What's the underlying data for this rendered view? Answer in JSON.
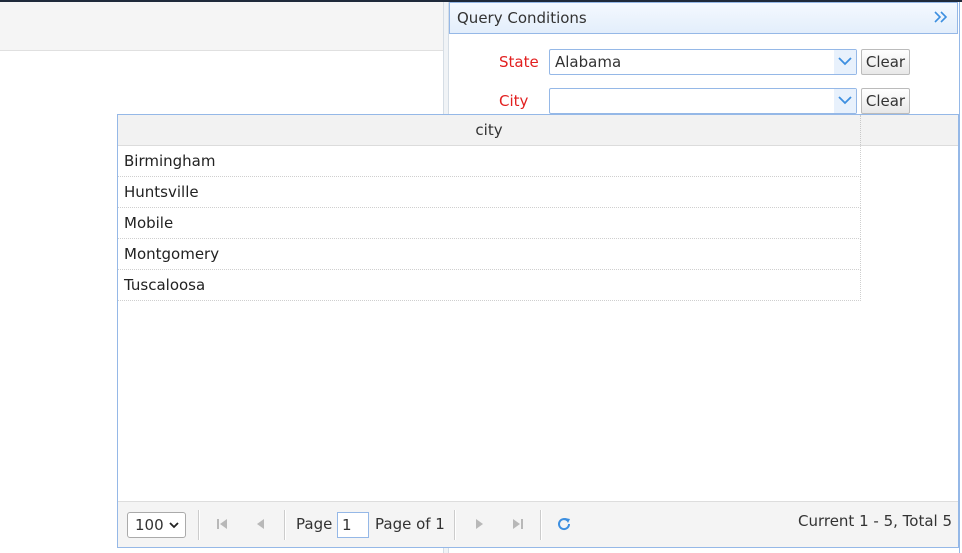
{
  "query_panel": {
    "title": "Query Conditions",
    "state_label": "State",
    "state_value": "Alabama",
    "city_label": "City",
    "city_value": "",
    "clear_label": "Clear"
  },
  "grid": {
    "column": "city",
    "rows": [
      "Birmingham",
      "Huntsville",
      "Mobile",
      "Montgomery",
      "Tuscaloosa"
    ]
  },
  "pager": {
    "page_size": "100",
    "page_label": "Page",
    "page_number": "1",
    "page_of": "Page of 1",
    "summary": "Current 1 - 5, Total 5"
  },
  "colors": {
    "accent_border": "#95b8e7",
    "label_red": "#e21f1f"
  }
}
